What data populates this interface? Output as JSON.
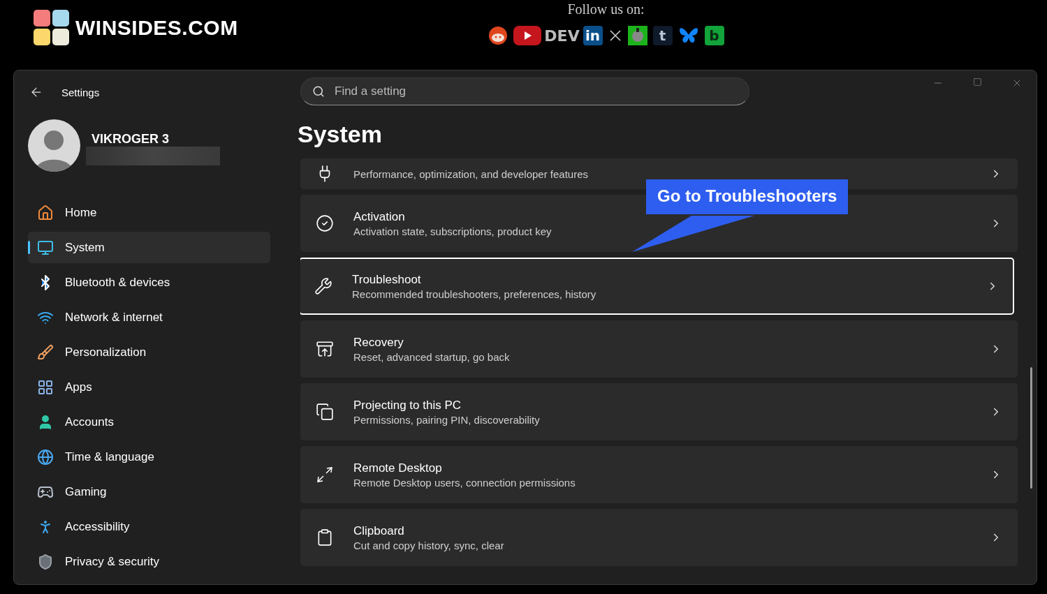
{
  "site": {
    "logo_text": "WINSIDES.COM",
    "follow_label": "Follow us on:",
    "socials": [
      {
        "kind": "reddit"
      },
      {
        "kind": "youtube"
      },
      {
        "kind": "dev",
        "label": "DEV"
      },
      {
        "kind": "linkedin",
        "label": "in"
      },
      {
        "kind": "x"
      },
      {
        "kind": "robot"
      },
      {
        "kind": "tumblr",
        "label": "t"
      },
      {
        "kind": "bluesky"
      },
      {
        "kind": "beacon",
        "label": "b"
      }
    ]
  },
  "window": {
    "title": "Settings"
  },
  "profile": {
    "name": "VIKROGER 3"
  },
  "nav": [
    {
      "label": "Home",
      "kind": "home",
      "selected": false
    },
    {
      "label": "System",
      "kind": "system",
      "selected": true
    },
    {
      "label": "Bluetooth & devices",
      "kind": "bluetooth",
      "selected": false
    },
    {
      "label": "Network & internet",
      "kind": "network",
      "selected": false
    },
    {
      "label": "Personalization",
      "kind": "brush",
      "selected": false
    },
    {
      "label": "Apps",
      "kind": "apps",
      "selected": false
    },
    {
      "label": "Accounts",
      "kind": "accounts",
      "selected": false
    },
    {
      "label": "Time & language",
      "kind": "time",
      "selected": false
    },
    {
      "label": "Gaming",
      "kind": "gaming",
      "selected": false
    },
    {
      "label": "Accessibility",
      "kind": "accessibility",
      "selected": false
    },
    {
      "label": "Privacy & security",
      "kind": "privacy",
      "selected": false
    }
  ],
  "search": {
    "placeholder": "Find a setting"
  },
  "page_title": "System",
  "cards": [
    {
      "kind": "advanced",
      "description": "Performance, optimization, and developer features",
      "selected": false
    },
    {
      "kind": "activation",
      "title": "Activation",
      "description": "Activation state, subscriptions, product key",
      "selected": false
    },
    {
      "kind": "troubleshoot",
      "title": "Troubleshoot",
      "description": "Recommended troubleshooters, preferences, history",
      "selected": true
    },
    {
      "kind": "recovery",
      "title": "Recovery",
      "description": "Reset, advanced startup, go back",
      "selected": false
    },
    {
      "kind": "projecting",
      "title": "Projecting to this PC",
      "description": "Permissions, pairing PIN, discoverability",
      "selected": false
    },
    {
      "kind": "remote",
      "title": "Remote Desktop",
      "description": "Remote Desktop users, connection permissions",
      "selected": false
    },
    {
      "kind": "clipboard",
      "title": "Clipboard",
      "description": "Cut and copy history, sync, clear",
      "selected": false
    }
  ],
  "callout": {
    "text": "Go to Troubleshooters"
  }
}
